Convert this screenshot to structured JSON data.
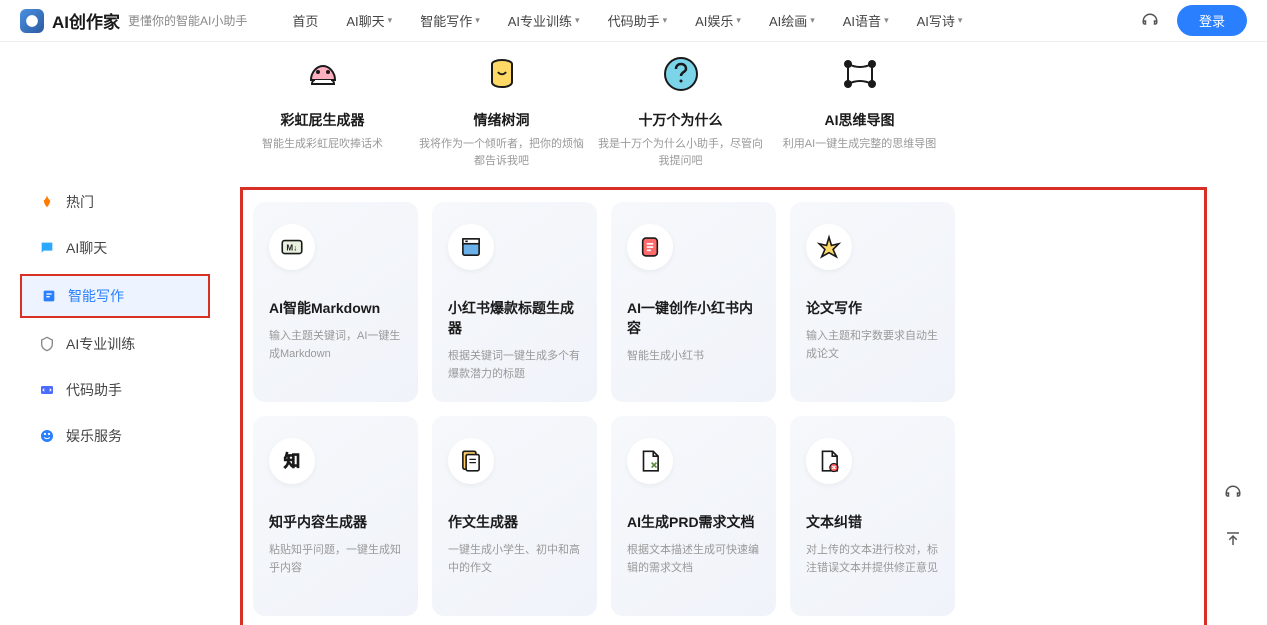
{
  "brand": {
    "name": "AI创作家",
    "tagline": "更懂你的智能AI小助手"
  },
  "nav": {
    "items": [
      {
        "label": "首页",
        "hasDropdown": false
      },
      {
        "label": "AI聊天",
        "hasDropdown": true
      },
      {
        "label": "智能写作",
        "hasDropdown": true
      },
      {
        "label": "AI专业训练",
        "hasDropdown": true
      },
      {
        "label": "代码助手",
        "hasDropdown": true
      },
      {
        "label": "AI娱乐",
        "hasDropdown": true
      },
      {
        "label": "AI绘画",
        "hasDropdown": true
      },
      {
        "label": "AI语音",
        "hasDropdown": true
      },
      {
        "label": "AI写诗",
        "hasDropdown": true
      }
    ]
  },
  "login_btn": "登录",
  "sidebar": {
    "items": [
      {
        "label": "热门",
        "color": "#ff7a00"
      },
      {
        "label": "AI聊天",
        "color": "#2a7fff"
      },
      {
        "label": "智能写作",
        "color": "#2a7fff",
        "active": true
      },
      {
        "label": "AI专业训练",
        "color": "#888"
      },
      {
        "label": "代码助手",
        "color": "#2a7fff"
      },
      {
        "label": "娱乐服务",
        "color": "#2a7fff"
      }
    ]
  },
  "top_row": [
    {
      "title": "彩虹屁生成器",
      "desc": "智能生成彩虹屁吹捧话术"
    },
    {
      "title": "情绪树洞",
      "desc": "我将作为一个倾听者，把你的烦恼都告诉我吧"
    },
    {
      "title": "十万个为什么",
      "desc": "我是十万个为什么小助手，尽管向我提问吧"
    },
    {
      "title": "AI思维导图",
      "desc": "利用AI一键生成完整的思维导图"
    }
  ],
  "cards": [
    {
      "title": "AI智能Markdown",
      "desc": "输入主题关键词，AI一键生成Markdown"
    },
    {
      "title": "小红书爆款标题生成器",
      "desc": "根据关键词一键生成多个有爆款潜力的标题"
    },
    {
      "title": "AI一键创作小红书内容",
      "desc": "智能生成小红书"
    },
    {
      "title": "论文写作",
      "desc": "输入主题和字数要求自动生成论文"
    },
    {
      "title": "知乎内容生成器",
      "desc": "粘贴知乎问题，一键生成知乎内容"
    },
    {
      "title": "作文生成器",
      "desc": "一键生成小学生、初中和高中的作文"
    },
    {
      "title": "AI生成PRD需求文档",
      "desc": "根据文本描述生成可快速编辑的需求文档"
    },
    {
      "title": "文本纠错",
      "desc": "对上传的文本进行校对，标注错误文本并提供修正意见"
    }
  ]
}
